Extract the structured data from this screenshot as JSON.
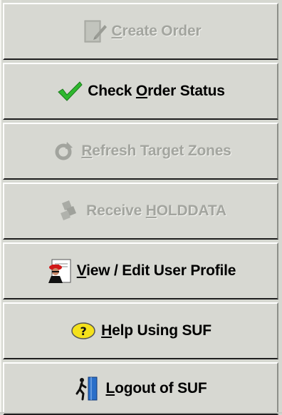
{
  "menu": {
    "items": [
      {
        "prefix": "",
        "mnemonic": "C",
        "suffix": "reate Order",
        "enabled": false,
        "icon": "edit-page-icon"
      },
      {
        "prefix": "Check ",
        "mnemonic": "O",
        "suffix": "rder Status",
        "enabled": true,
        "icon": "check-icon"
      },
      {
        "prefix": "",
        "mnemonic": "R",
        "suffix": "efresh Target Zones",
        "enabled": false,
        "icon": "refresh-icon"
      },
      {
        "prefix": "Receive ",
        "mnemonic": "H",
        "suffix": "OLDDATA",
        "enabled": false,
        "icon": "receive-icon"
      },
      {
        "prefix": "",
        "mnemonic": "V",
        "suffix": "iew / Edit User Profile",
        "enabled": true,
        "icon": "user-profile-icon"
      },
      {
        "prefix": "",
        "mnemonic": "H",
        "suffix": "elp Using SUF",
        "enabled": true,
        "icon": "help-icon"
      },
      {
        "prefix": "",
        "mnemonic": "L",
        "suffix": "ogout of SUF",
        "enabled": true,
        "icon": "logout-icon"
      }
    ]
  },
  "colors": {
    "enabled_text": "#000000",
    "disabled_text": "#a3a59f",
    "check_green": "#2eb82e",
    "help_yellow": "#f4e11b"
  }
}
